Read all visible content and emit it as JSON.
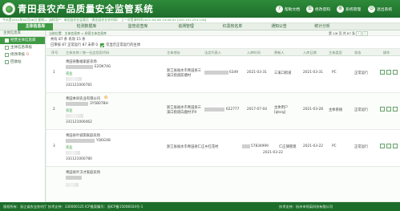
{
  "header": {
    "title": "青田县农产品质量安全监管系统",
    "buttons": [
      {
        "label": "帮助文档",
        "icon": "help-icon"
      },
      {
        "label": "修改密码",
        "icon": "key-icon"
      },
      {
        "label": "系统管理",
        "icon": "gear-icon"
      },
      {
        "label": "退出系统",
        "icon": "power-icon"
      }
    ]
  },
  "infobar": {
    "text": "今天是2021年04月06日 星期二 当前用户：青田县农业监管员（青田县农业农村局） 上一次登录时间2021-04-06 14:40:01 [220.191.254.126]"
  },
  "nav": {
    "tabs": [
      "主体信息库",
      "检测数据库",
      "监管巡查库",
      "追溯管理",
      "红黑榜名单",
      "通知公告",
      "统计分析"
    ],
    "active": 0
  },
  "sidebar": {
    "header": "主体信息库",
    "items": [
      {
        "label": "经营主体信息库",
        "active": true
      },
      {
        "label": "主体信息审核",
        "active": false
      },
      {
        "label": "修改审核",
        "active": false,
        "badge": "0"
      },
      {
        "label": "回收站",
        "active": false
      }
    ]
  },
  "breadcrumb": "当前位置：主体信息库 > 经营主体信息库",
  "pager": {
    "text": "第 1/6 页 共 87 条",
    "prev": "‹",
    "next": "›"
  },
  "toolbar": {
    "line1": "共有 87 条  有效 15 条",
    "line2_prefix": "已审核 87   正常运行 87   未审 0",
    "checkbox_label": "仅显示正常运行的主体"
  },
  "table": {
    "headers": [
      "序号",
      "主体名称 / 统一社会信用代码",
      "主体地址",
      "法定代表人",
      "入库时间",
      "更新人",
      "入库日期",
      "主体类型",
      "状态",
      "操作"
    ],
    "rows": [
      {
        "index": "1",
        "name": "青田县勤福家庭农场",
        "code_tail": "E2DK74G",
        "tag": "农业",
        "phone": "331121000781",
        "address": "浙江省丽水市青田县三溪口街道前塘村",
        "legal_tail": "6349",
        "join_date": "2021-03-31",
        "updater": "三溪口街道",
        "update_date": "2021-03-31",
        "type": "PC",
        "status": "正常运行"
      },
      {
        "index": "2",
        "name": "青田本尚农业有限公司",
        "code_tail": "3Y5B07BH",
        "tag": "农业",
        "phone": "331121000462",
        "address": "浙江省丽水市青田县三溪口街道白鹿村子9",
        "legal_tail": "622777",
        "join_date": "2017-07-04",
        "updater": "主体用户 [qtsrg]",
        "update_date": "2021-03-28",
        "type": "主体系统",
        "status": "正常运行"
      },
      {
        "index": "3",
        "name": "青田县叶城南家庭农场",
        "code_tail": "YQ6GX8",
        "tag": "农业",
        "phone": "331121000780",
        "address": "浙江省丽水市青田县仁庄乡红花村",
        "legal_tail": "57834999",
        "join_date": "2021-03-22",
        "updater": "仁庄镇管理",
        "update_date": "2021-03-22",
        "type": "PC",
        "status": "正常运行"
      },
      {
        "index": "4",
        "name": "青田县叶汉才家庭农场",
        "code_tail": "",
        "tag": "",
        "phone": "",
        "address": "",
        "legal_tail": "",
        "join_date": "",
        "updater": "",
        "update_date": "",
        "type": "",
        "status": ""
      }
    ]
  },
  "footer": {
    "left": "版权所有：浙江省农业农村厅 技术支持：330000125 ICP备案编号：浙ICP备15008104号-1",
    "right": "技术支持：杭州市领英科技有限公司"
  },
  "colors": {
    "brand": "#1d6d2a",
    "accent": "#3f9a44",
    "status_ok": "#2e9a3a"
  }
}
